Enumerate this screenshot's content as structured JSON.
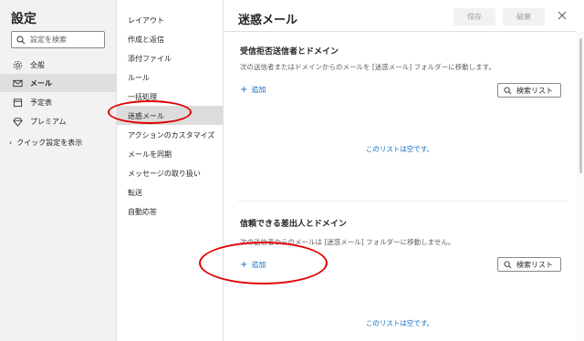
{
  "left": {
    "title": "設定",
    "search_placeholder": "設定を検索",
    "items": [
      {
        "label": "全般",
        "icon": "gear-icon"
      },
      {
        "label": "メール",
        "icon": "mail-icon",
        "active": true
      },
      {
        "label": "予定表",
        "icon": "calendar-icon"
      },
      {
        "label": "プレミアム",
        "icon": "diamond-icon"
      }
    ],
    "quick": "クイック設定を表示"
  },
  "middle": {
    "items": [
      {
        "label": "レイアウト"
      },
      {
        "label": "作成と返信"
      },
      {
        "label": "添付ファイル"
      },
      {
        "label": "ルール"
      },
      {
        "label": "一括処理"
      },
      {
        "label": "迷惑メール",
        "active": true
      },
      {
        "label": "アクションのカスタマイズ"
      },
      {
        "label": "メールを同期"
      },
      {
        "label": "メッセージの取り扱い"
      },
      {
        "label": "転送"
      },
      {
        "label": "自動応答"
      }
    ]
  },
  "main": {
    "title": "迷惑メール",
    "save": "保存",
    "discard": "破棄",
    "blocked": {
      "title": "受信拒否送信者とドメイン",
      "desc": "次の送信者またはドメインからのメールを [迷惑メール] フォルダーに移動します。",
      "add": "追加",
      "search": "検索リスト",
      "empty": "このリストは空です。"
    },
    "safe": {
      "title": "信頼できる差出人とドメイン",
      "desc": "次の送信者からのメールは [迷惑メール] フォルダーに移動しません。",
      "add": "追加",
      "search": "検索リスト",
      "empty": "このリストは空です。"
    }
  },
  "colors": {
    "accent": "#0f6cbd",
    "annotation": "#e00000"
  }
}
